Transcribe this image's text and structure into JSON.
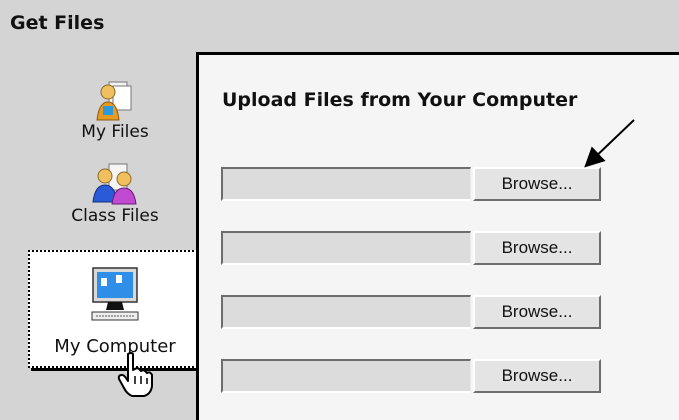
{
  "header": {
    "title": "Get Files"
  },
  "sidebar": {
    "items": [
      {
        "label": "My Files",
        "icon": "my-files-icon"
      },
      {
        "label": "Class Files",
        "icon": "class-files-icon"
      },
      {
        "label": "My Computer",
        "icon": "my-computer-icon",
        "selected": true
      }
    ]
  },
  "upload": {
    "title": "Upload Files from Your Computer",
    "rows": [
      {
        "value": "",
        "button_label": "Browse..."
      },
      {
        "value": "",
        "button_label": "Browse..."
      },
      {
        "value": "",
        "button_label": "Browse..."
      },
      {
        "value": "",
        "button_label": "Browse..."
      }
    ]
  },
  "colors": {
    "background": "#d4d4d4",
    "panel": "#f5f5f5",
    "selected_item": "#ffffff",
    "monitor_screen": "#2f8fe8"
  }
}
